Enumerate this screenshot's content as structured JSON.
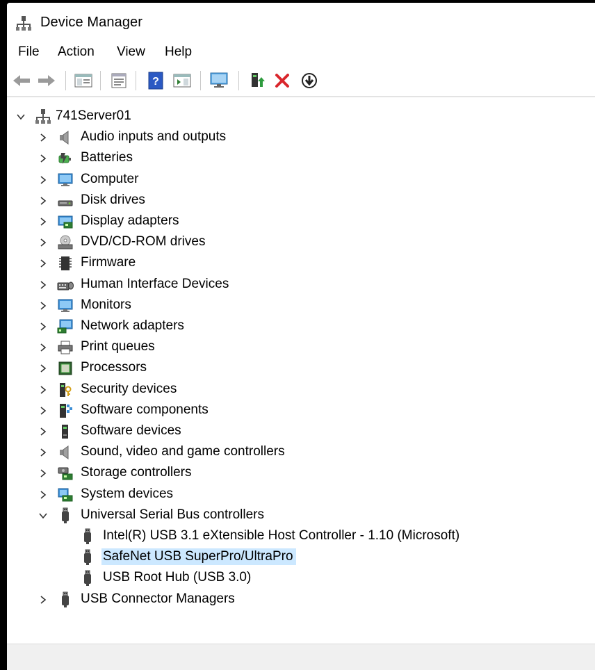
{
  "window": {
    "title": "Device Manager"
  },
  "menu": [
    "File",
    "Action",
    "View",
    "Help"
  ],
  "toolbar": {
    "buttons": [
      "back-icon",
      "forward-icon",
      "show-hide-console-tree-icon",
      "properties-icon",
      "help-icon",
      "action-pane-icon",
      "scan-hardware-icon",
      "update-driver-icon",
      "uninstall-device-icon",
      "enable-device-icon"
    ]
  },
  "tree": {
    "root": "741Server01",
    "categories": [
      {
        "label": "Audio inputs and outputs",
        "icon": "speaker-icon"
      },
      {
        "label": "Batteries",
        "icon": "battery-icon"
      },
      {
        "label": "Computer",
        "icon": "computer-icon"
      },
      {
        "label": "Disk drives",
        "icon": "disk-drive-icon"
      },
      {
        "label": "Display adapters",
        "icon": "display-adapter-icon"
      },
      {
        "label": "DVD/CD-ROM drives",
        "icon": "dvd-drive-icon"
      },
      {
        "label": "Firmware",
        "icon": "firmware-icon"
      },
      {
        "label": "Human Interface Devices",
        "icon": "hid-icon"
      },
      {
        "label": "Monitors",
        "icon": "monitor-icon"
      },
      {
        "label": "Network adapters",
        "icon": "network-adapter-icon"
      },
      {
        "label": "Print queues",
        "icon": "printer-icon"
      },
      {
        "label": "Processors",
        "icon": "processor-icon"
      },
      {
        "label": "Security devices",
        "icon": "security-device-icon"
      },
      {
        "label": "Software components",
        "icon": "software-component-icon"
      },
      {
        "label": "Software devices",
        "icon": "software-device-icon"
      },
      {
        "label": "Sound, video and game controllers",
        "icon": "speaker-icon"
      },
      {
        "label": "Storage controllers",
        "icon": "storage-controller-icon"
      },
      {
        "label": "System devices",
        "icon": "system-device-icon"
      },
      {
        "label": "Universal Serial Bus controllers",
        "icon": "usb-icon",
        "expanded": true
      },
      {
        "label": "USB Connector Managers",
        "icon": "usb-icon"
      }
    ],
    "usb_children": [
      {
        "label": "Intel(R) USB 3.1 eXtensible Host Controller - 1.10 (Microsoft)"
      },
      {
        "label": "SafeNet USB SuperPro/UltraPro",
        "selected": true
      },
      {
        "label": "USB Root Hub (USB 3.0)"
      }
    ]
  },
  "colors": {
    "selection": "#cce8ff",
    "accent": "#1e73be",
    "uninstall_red": "#d9262c"
  }
}
